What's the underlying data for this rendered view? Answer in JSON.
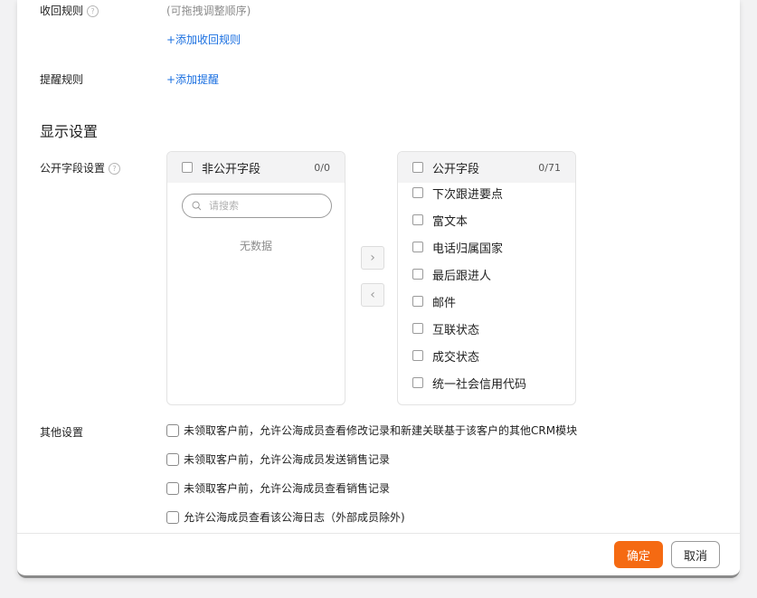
{
  "recall_rules": {
    "label": "收回规则",
    "hint": "(可拖拽调整顺序)",
    "add_link": "+添加收回规则"
  },
  "reminder_rules": {
    "label": "提醒规则",
    "add_link": "+添加提醒"
  },
  "display_settings": {
    "title": "显示设置",
    "public_fields_label": "公开字段设置"
  },
  "transfer": {
    "left": {
      "title": "非公开字段",
      "count": "0/0",
      "search_placeholder": "请搜索",
      "empty_text": "无数据"
    },
    "right": {
      "title": "公开字段",
      "count": "0/71",
      "items": [
        "下次跟进要点",
        "富文本",
        "电话归属国家",
        "最后跟进人",
        "邮件",
        "互联状态",
        "成交状态",
        "统一社会信用代码"
      ]
    },
    "to_right_glyph": "›",
    "to_left_glyph": "‹"
  },
  "other_settings": {
    "label": "其他设置",
    "options": [
      "未领取客户前，允许公海成员查看修改记录和新建关联基于该客户的其他CRM模块",
      "未领取客户前，允许公海成员发送销售记录",
      "未领取客户前，允许公海成员查看销售记录",
      "允许公海成员查看该公海日志（外部成员除外)"
    ]
  },
  "footer": {
    "confirm_label": "确定",
    "cancel_label": "取消"
  },
  "colors": {
    "accent": "#f56a12",
    "link": "#1a6fe0"
  }
}
